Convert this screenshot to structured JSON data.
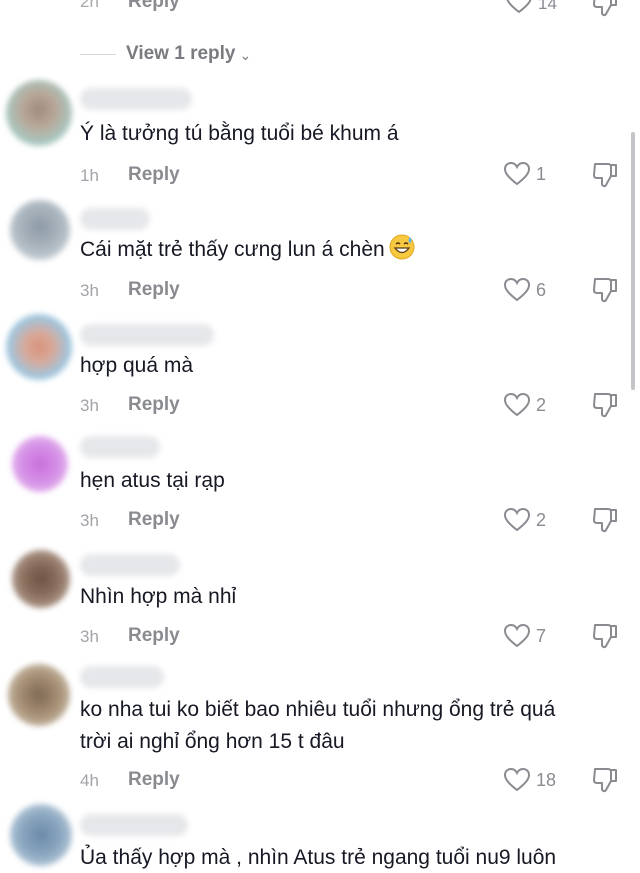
{
  "top_partial": {
    "time": "2h",
    "reply_label": "Reply",
    "like_count": "14"
  },
  "view_replies": {
    "label": "View 1 reply",
    "chevron_icon": "chevron-down-icon"
  },
  "comments": [
    {
      "text": "Ý là tưởng tú bằng tuổi bé khum á",
      "time": "1h",
      "reply_label": "Reply",
      "likes": "1"
    },
    {
      "text": "Cái mặt trẻ thấy cưng lun á chèn",
      "emoji": "grinning-sweat-emoji",
      "time": "3h",
      "reply_label": "Reply",
      "likes": "6"
    },
    {
      "text": "hợp quá mà",
      "time": "3h",
      "reply_label": "Reply",
      "likes": "2"
    },
    {
      "text": "hẹn atus tại rạp",
      "time": "3h",
      "reply_label": "Reply",
      "likes": "2"
    },
    {
      "text": "Nhìn hợp mà nhỉ",
      "time": "3h",
      "reply_label": "Reply",
      "likes": "7"
    },
    {
      "text_line1": "ko nha tui ko biết bao nhiêu tuổi nhưng ổng trẻ quá",
      "text_line2": "trời ai nghỉ ổng hơn 15 t đâu",
      "time": "4h",
      "reply_label": "Reply",
      "likes": "18"
    },
    {
      "text": "Ủa thấy hợp mà , nhìn Atus trẻ ngang tuổi nu9 luôn"
    }
  ],
  "icons": {
    "like": "heart-outline-icon",
    "dislike": "thumbs-down-outline-icon"
  },
  "colors": {
    "text": "#161823",
    "muted": "#8a8b91",
    "time": "#a3a4a9"
  }
}
